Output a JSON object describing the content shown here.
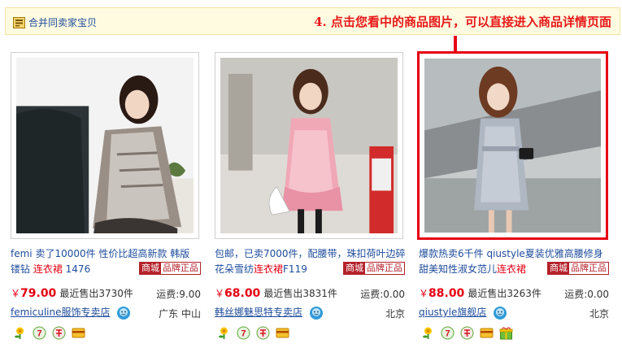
{
  "header": {
    "merge_label": "合并同卖家宝贝",
    "tip": "4. 点击您看中的商品图片，可以直接进入商品详情页面"
  },
  "colors": {
    "accent": "#e60012",
    "link": "#1e4c9c",
    "tip_bar_bg": "#fffbe0"
  },
  "products": [
    {
      "title_pre": "femi 卖了10000件 性价比超高新款 韩版 镂钻 ",
      "title_keyword": "连衣裙",
      "title_post": " 1476",
      "badge_a": "商城",
      "badge_b": "品牌正品",
      "yen": "￥",
      "price": "79.00",
      "sold": "最近售出3730件",
      "shipping": "运费:9.00",
      "shop": "femiculine服饰专卖店",
      "location": "广东 中山",
      "services": [
        "flower-icon",
        "seven-day-return-icon",
        "guarantee-icon",
        "credit-card-icon"
      ]
    },
    {
      "title_pre": "包邮，已卖7000件，配腰带，珠扣荷叶边碎花朵雪纺",
      "title_keyword": "连衣裙",
      "title_post": "F119",
      "badge_a": "商城",
      "badge_b": "品牌正品",
      "yen": "￥",
      "price": "68.00",
      "sold": "最近售出3831件",
      "shipping": "运费:0.00",
      "shop": "韩丝娜魅思特专卖店",
      "location": "北京",
      "services": [
        "flower-icon",
        "seven-day-return-icon",
        "guarantee-icon",
        "credit-card-icon"
      ]
    },
    {
      "title_pre": "爆款热卖6千件 qiustyle夏装优雅高腰修身甜美知性淑女范儿",
      "title_keyword": "连衣裙",
      "title_post": "",
      "badge_a": "商城",
      "badge_b": "品牌正品",
      "yen": "￥",
      "price": "88.00",
      "sold": "最近售出3263件",
      "shipping": "运费:0.00",
      "shop": "qiustyle旗舰店",
      "location": "北京",
      "services": [
        "flower-icon",
        "seven-day-return-icon",
        "guarantee-icon",
        "credit-card-icon",
        "gift-icon"
      ]
    }
  ]
}
